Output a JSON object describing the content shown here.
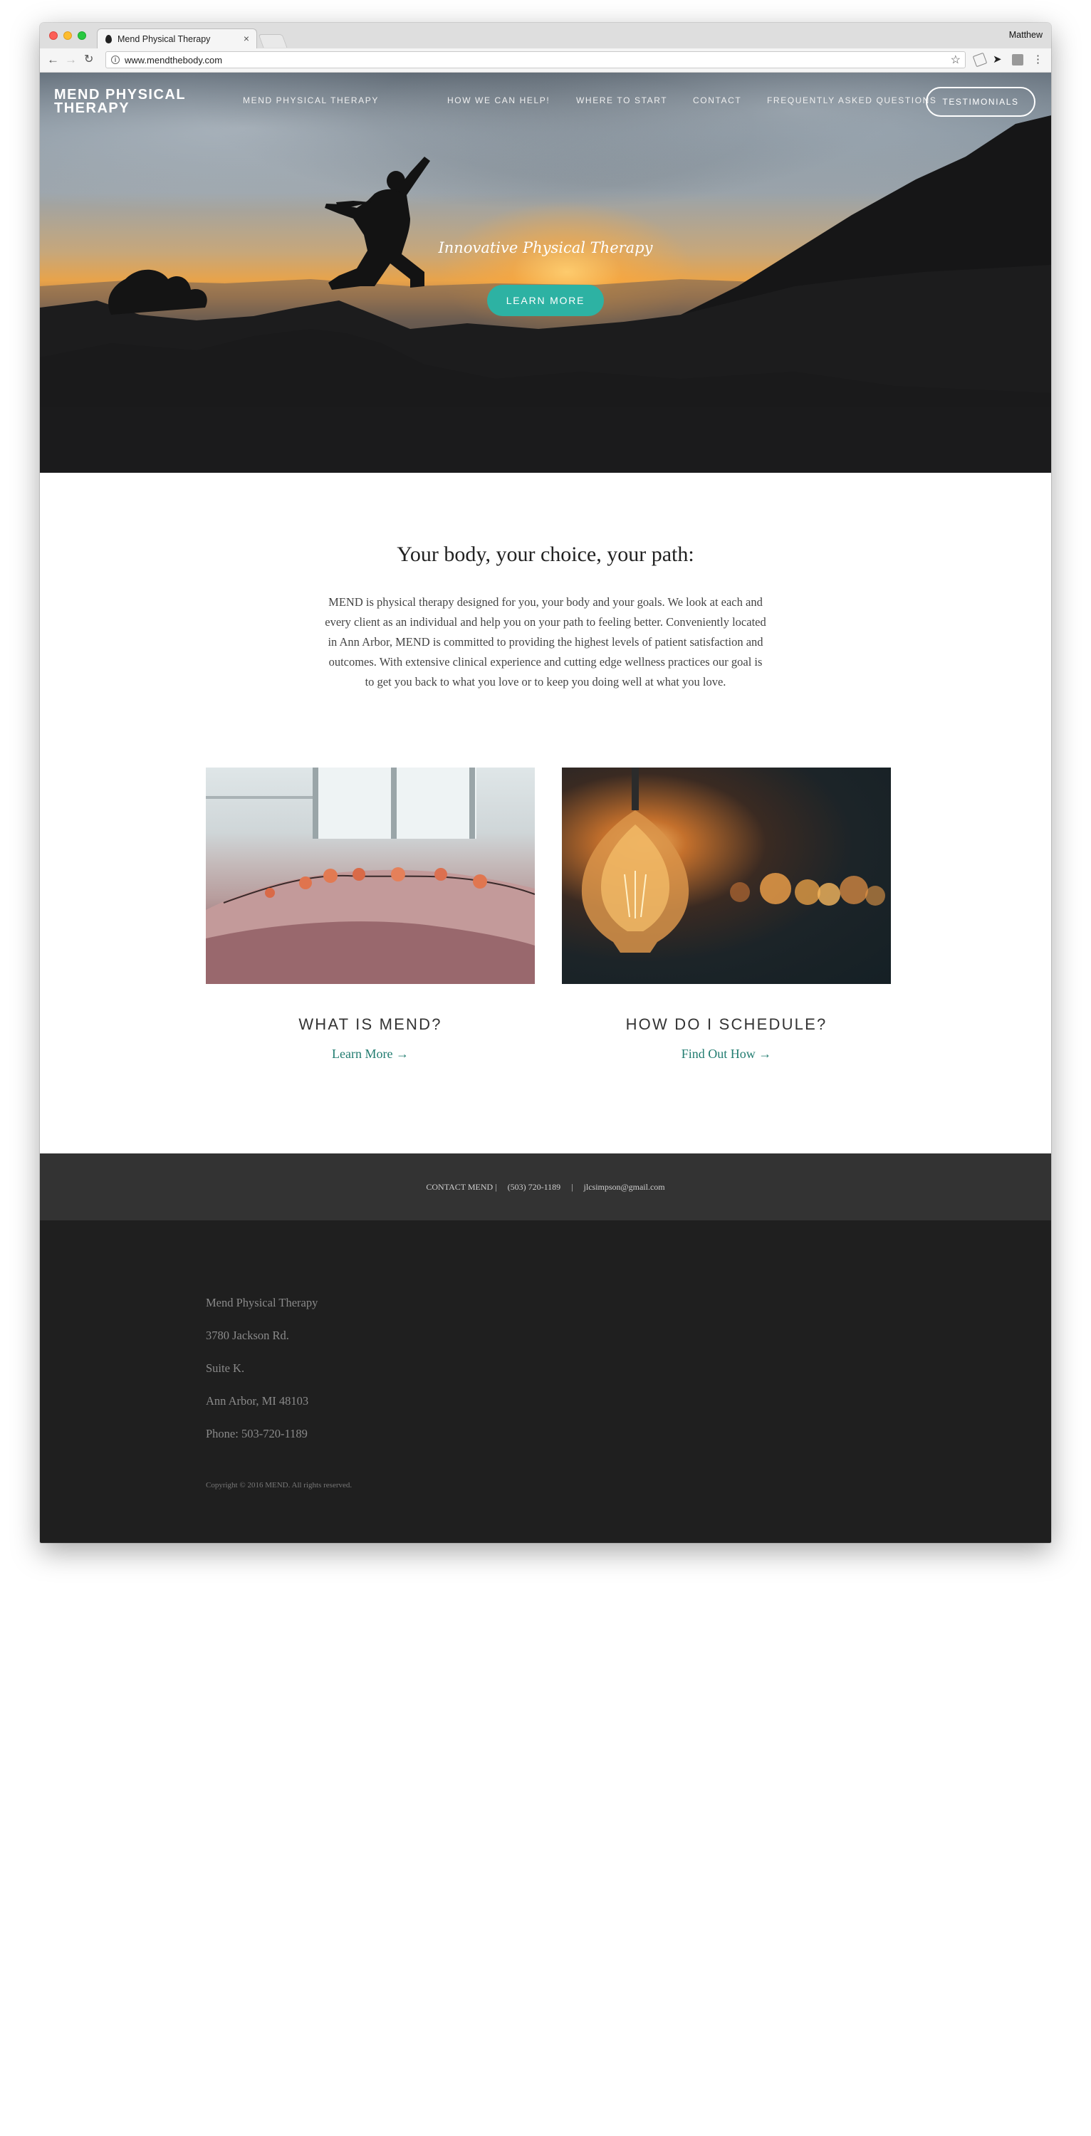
{
  "browser": {
    "tab_title": "Mend Physical Therapy",
    "tab_close": "×",
    "profile_name": "Matthew",
    "url": "www.mendthebody.com"
  },
  "site": {
    "logo": "MEND PHYSICAL THERAPY",
    "nav": [
      "MEND PHYSICAL THERAPY",
      "HOW WE CAN HELP!",
      "WHERE TO START",
      "CONTACT",
      "FREQUENTLY ASKED QUESTIONS"
    ],
    "testimonials": "TESTIMONIALS"
  },
  "hero": {
    "tagline": "Innovative Physical Therapy",
    "button": "LEARN MORE"
  },
  "intro": {
    "heading": "Your body, your choice, your path:",
    "body": "MEND is physical therapy designed for you, your body and your goals.  We look at each and every client as an individual and help you on your path to feeling better.  Conveniently located in Ann Arbor, MEND is committed to providing the highest levels of patient satisfaction and outcomes.  With extensive clinical experience and cutting edge wellness practices our goal is to get you back to what you love or to keep you doing well at what you love."
  },
  "cards": [
    {
      "title": "WHAT IS MEND?",
      "link": "Learn More →"
    },
    {
      "title": "HOW DO I SCHEDULE?",
      "link": "Find Out How →"
    }
  ],
  "contact_bar": {
    "text": "CONTACT MEND |     (503) 720-1189     |     jlcsimpson@gmail.com"
  },
  "footer": {
    "lines": [
      "Mend Physical Therapy",
      "3780 Jackson Rd.",
      "Suite K.",
      "Ann Arbor, MI 48103",
      "Phone: 503-720-1189"
    ],
    "copyright": "Copyright © 2016 MEND. All rights reserved."
  },
  "colors": {
    "accent": "#2db2a3",
    "link": "#217c70",
    "contact_bar": "#333333",
    "footer": "#1f1f1f"
  },
  "icons": [
    "info-icon",
    "star-icon",
    "back-arrow-icon",
    "forward-arrow-icon",
    "reload-icon",
    "menu-icon"
  ]
}
